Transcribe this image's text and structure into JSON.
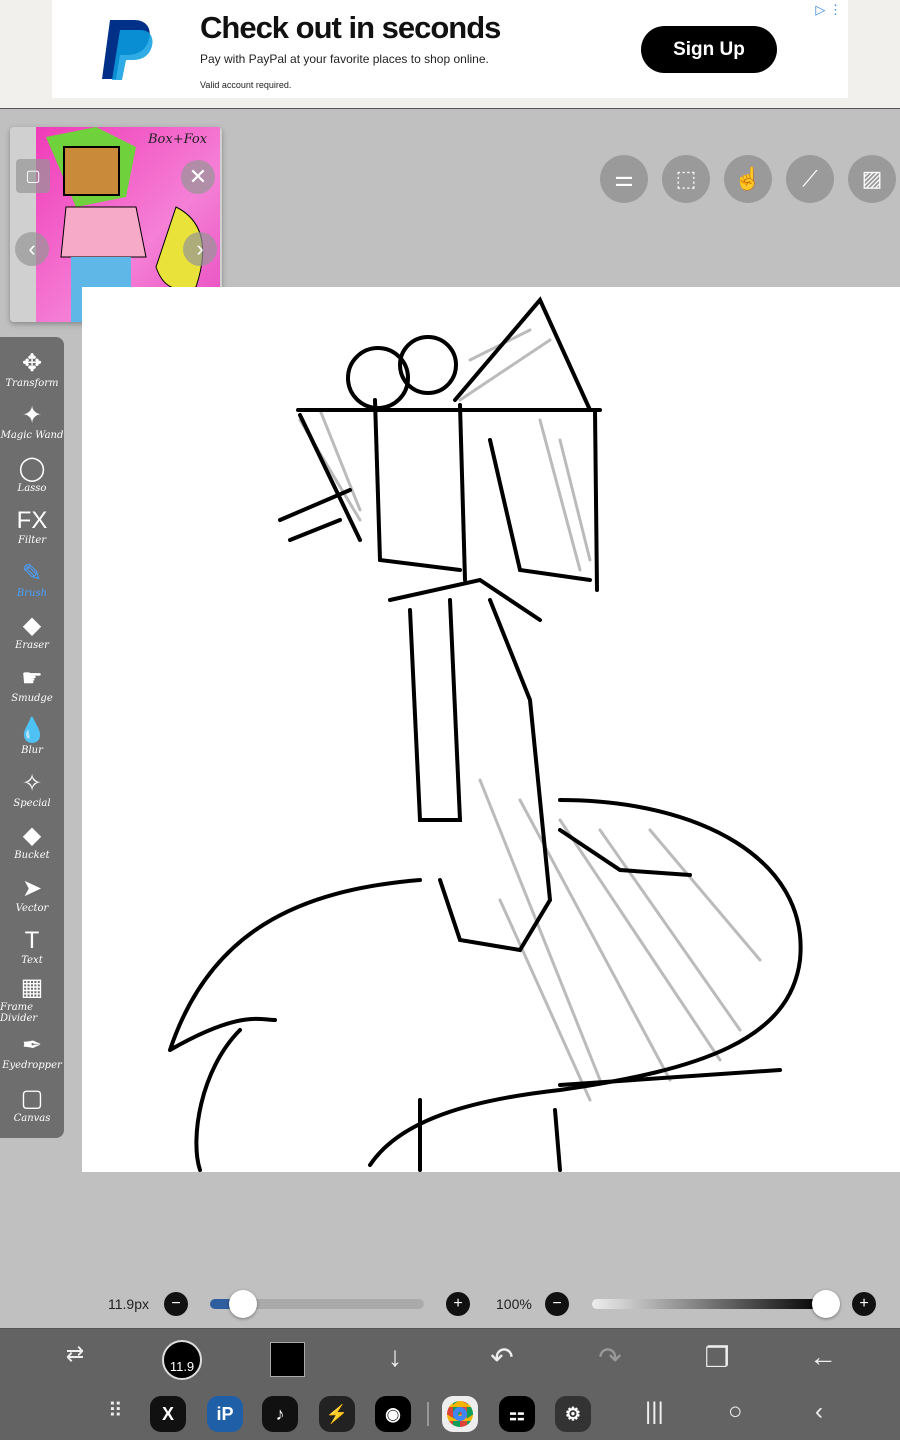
{
  "ad": {
    "title": "Check out in seconds",
    "subtitle": "Pay with PayPal at your favorite places to shop online.",
    "disclaimer": "Valid account required.",
    "cta": "Sign Up",
    "brand_color": "#003087"
  },
  "reference": {
    "label": "Box+Fox"
  },
  "top_buttons": [
    "toggle-icon",
    "selection-icon",
    "hand-touch-icon",
    "ruler-icon",
    "image-icon"
  ],
  "tools": [
    {
      "label": "Transform",
      "icon": "✥"
    },
    {
      "label": "Magic Wand",
      "icon": "✦"
    },
    {
      "label": "Lasso",
      "icon": "◯"
    },
    {
      "label": "Filter",
      "icon": "FX"
    },
    {
      "label": "Brush",
      "icon": "✎",
      "active": true
    },
    {
      "label": "Eraser",
      "icon": "◆"
    },
    {
      "label": "Smudge",
      "icon": "☛"
    },
    {
      "label": "Blur",
      "icon": "💧"
    },
    {
      "label": "Special",
      "icon": "✧"
    },
    {
      "label": "Bucket",
      "icon": "◆"
    },
    {
      "label": "Vector",
      "icon": "➤"
    },
    {
      "label": "Text",
      "icon": "T"
    },
    {
      "label": "Frame Divider",
      "icon": "▦"
    },
    {
      "label": "Eyedropper",
      "icon": "✒"
    },
    {
      "label": "Canvas",
      "icon": "▢"
    }
  ],
  "brush": {
    "size_label": "11.9px",
    "size_badge": "11.9",
    "size_fraction": 0.09,
    "opacity_label": "100%",
    "opacity": 1.0,
    "accent": "#2f5f9e"
  },
  "color": "#000000",
  "apps": [
    "X",
    "ibis Paint",
    "TikTok",
    "Power",
    "Discord",
    "Chrome",
    "Connect",
    "Settings"
  ]
}
